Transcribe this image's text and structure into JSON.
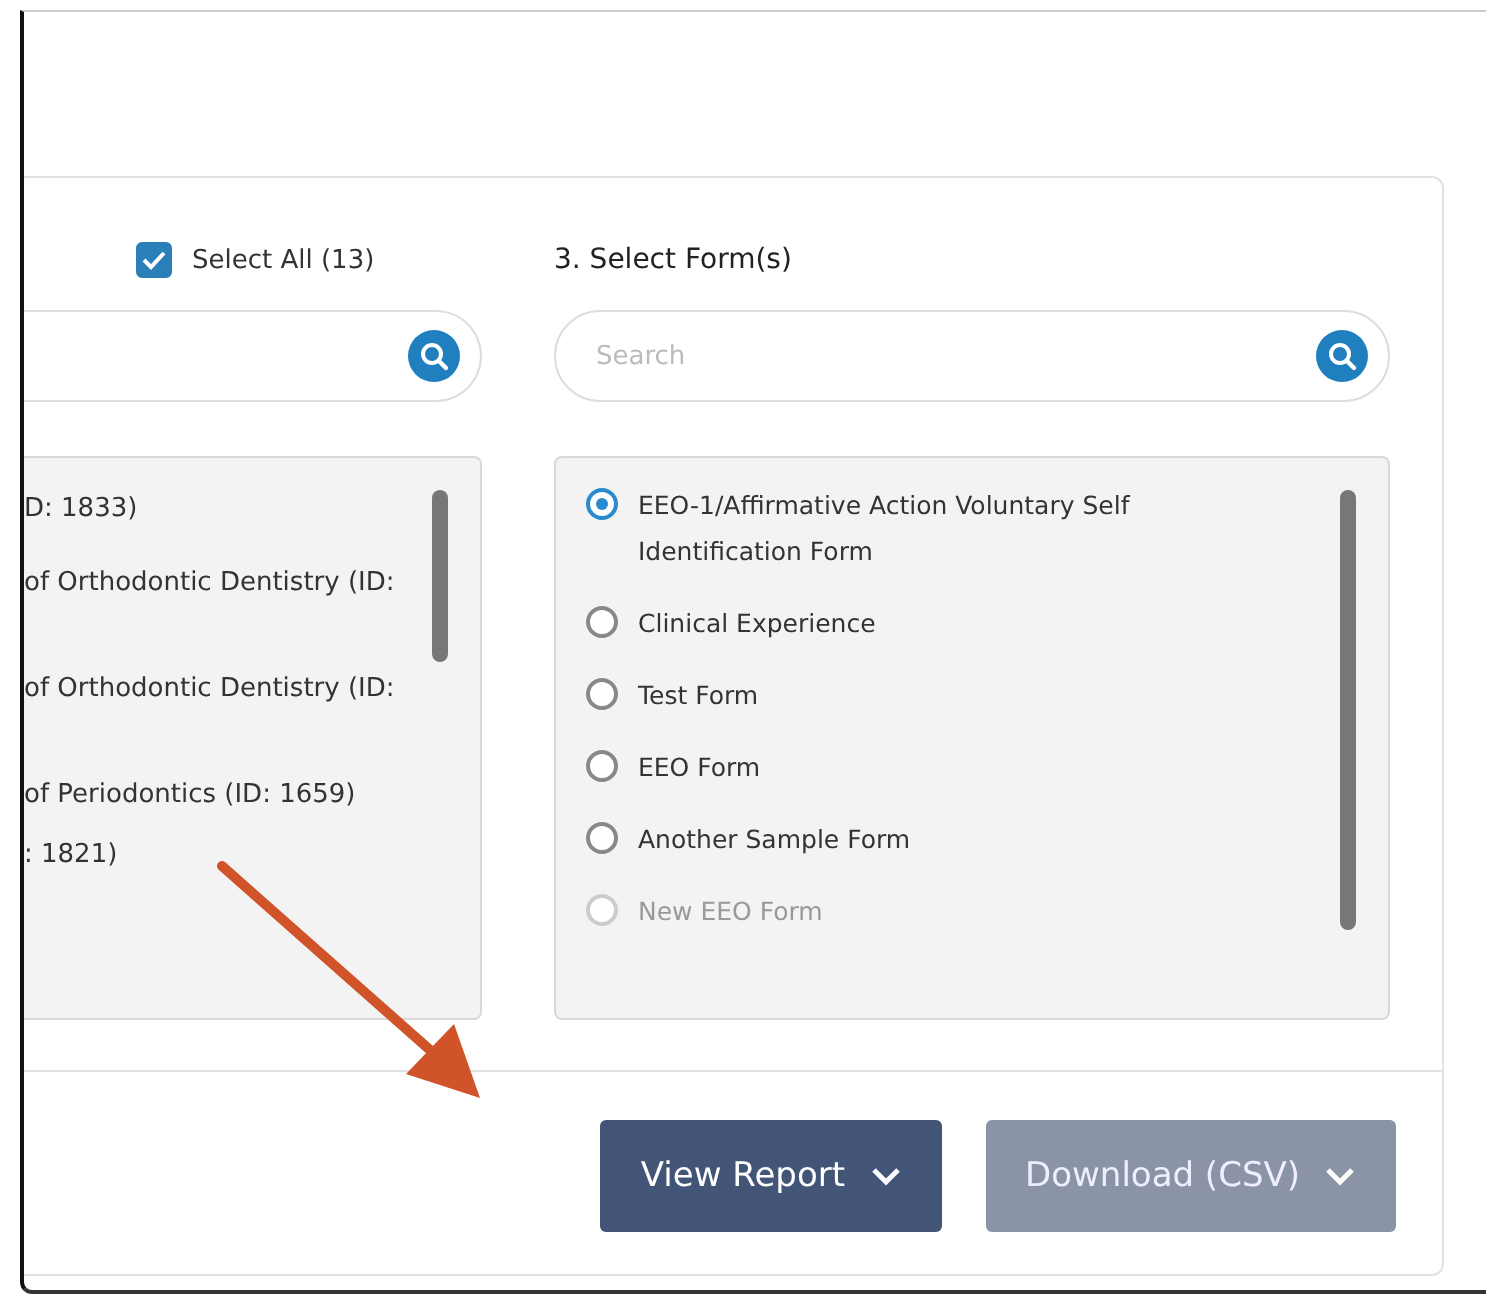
{
  "forms_column": {
    "select_all": {
      "label": "Select All (13)",
      "checked": true
    },
    "list_lines": [
      "D: 1833)",
      "of Orthodontic Dentistry (ID:",
      "of Orthodontic Dentistry (ID:",
      "of Periodontics (ID: 1659)",
      ": 1821)"
    ]
  },
  "form_column": {
    "title": "3. Select Form(s)",
    "search": {
      "placeholder": "Search"
    },
    "forms": [
      {
        "label": "EEO-1/Affirmative Action Voluntary Self Identification Form",
        "selected": true,
        "disabled": false
      },
      {
        "label": "Clinical Experience",
        "selected": false,
        "disabled": false
      },
      {
        "label": "Test Form",
        "selected": false,
        "disabled": false
      },
      {
        "label": "EEO Form",
        "selected": false,
        "disabled": false
      },
      {
        "label": "Another Sample Form",
        "selected": false,
        "disabled": false
      },
      {
        "label": "New EEO Form",
        "selected": false,
        "disabled": true
      }
    ]
  },
  "buttons": [
    {
      "label": "View Report",
      "disabled": false
    },
    {
      "label": "Download (CSV)",
      "disabled": true
    }
  ]
}
